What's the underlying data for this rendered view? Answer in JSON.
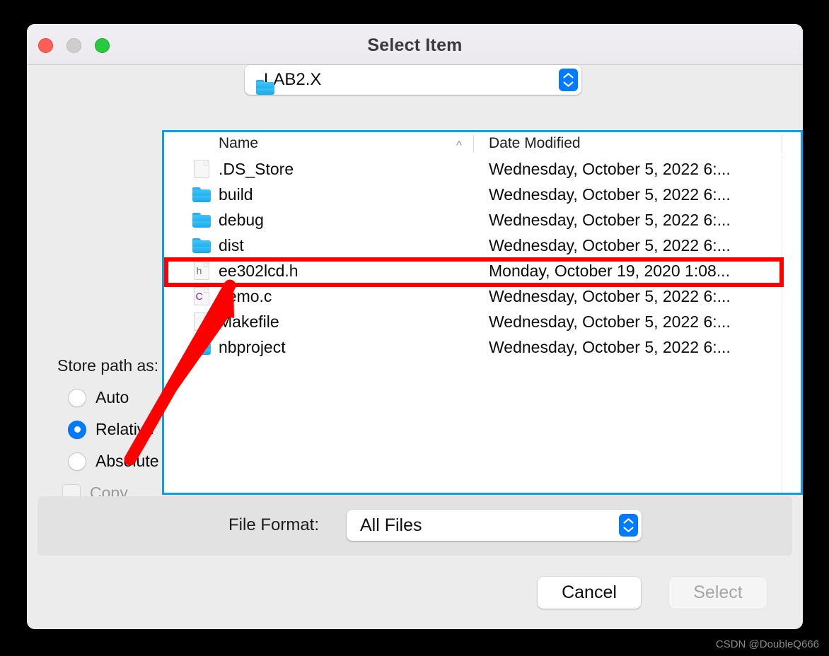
{
  "window": {
    "title": "Select Item",
    "traffic_lights": [
      "close-button",
      "minimize-button",
      "zoom-button"
    ]
  },
  "path_popup": {
    "value": "LAB2.X",
    "icon": "folder-icon"
  },
  "file_list": {
    "columns": [
      "Name",
      "Date Modified"
    ],
    "sort_indicator": "^",
    "rows": [
      {
        "icon": "document-icon",
        "name": ".DS_Store",
        "date": "Wednesday, October 5, 2022 6:...",
        "extra": ""
      },
      {
        "icon": "folder-icon",
        "name": "build",
        "date": "Wednesday, October 5, 2022 6:...",
        "extra": ""
      },
      {
        "icon": "folder-icon",
        "name": "debug",
        "date": "Wednesday, October 5, 2022 6:...",
        "extra": ""
      },
      {
        "icon": "folder-icon",
        "name": "dist",
        "date": "Wednesday, October 5, 2022 6:...",
        "extra": ""
      },
      {
        "icon": "header-file-icon",
        "name": "ee302lcd.h",
        "date": "Monday, October 19, 2020 1:08...",
        "extra": ""
      },
      {
        "icon": "c-source-file-icon",
        "name": "demo.c",
        "date": "Wednesday, October 5, 2022 6:...",
        "extra": ""
      },
      {
        "icon": "document-icon",
        "name": "Makefile",
        "date": "Wednesday, October 5, 2022 6:...",
        "extra": ""
      },
      {
        "icon": "folder-icon",
        "name": "nbproject",
        "date": "Wednesday, October 5, 2022 6:...",
        "extra": ""
      }
    ]
  },
  "store_path": {
    "label": "Store path as:",
    "options": [
      {
        "label": "Auto",
        "selected": false
      },
      {
        "label": "Relative",
        "selected": true
      },
      {
        "label": "Absolute",
        "selected": false
      }
    ],
    "copy": {
      "label": "Copy",
      "checked": false,
      "enabled": false
    }
  },
  "file_format": {
    "label": "File Format:",
    "value": "All Files"
  },
  "buttons": {
    "cancel": "Cancel",
    "select": "Select"
  },
  "colors": {
    "accent": "#007aff",
    "focus_ring": "#0a9ff5",
    "annotation": "#fe0000",
    "folder": "#2eb0ef"
  },
  "watermark": "CSDN @DoubleQ666"
}
